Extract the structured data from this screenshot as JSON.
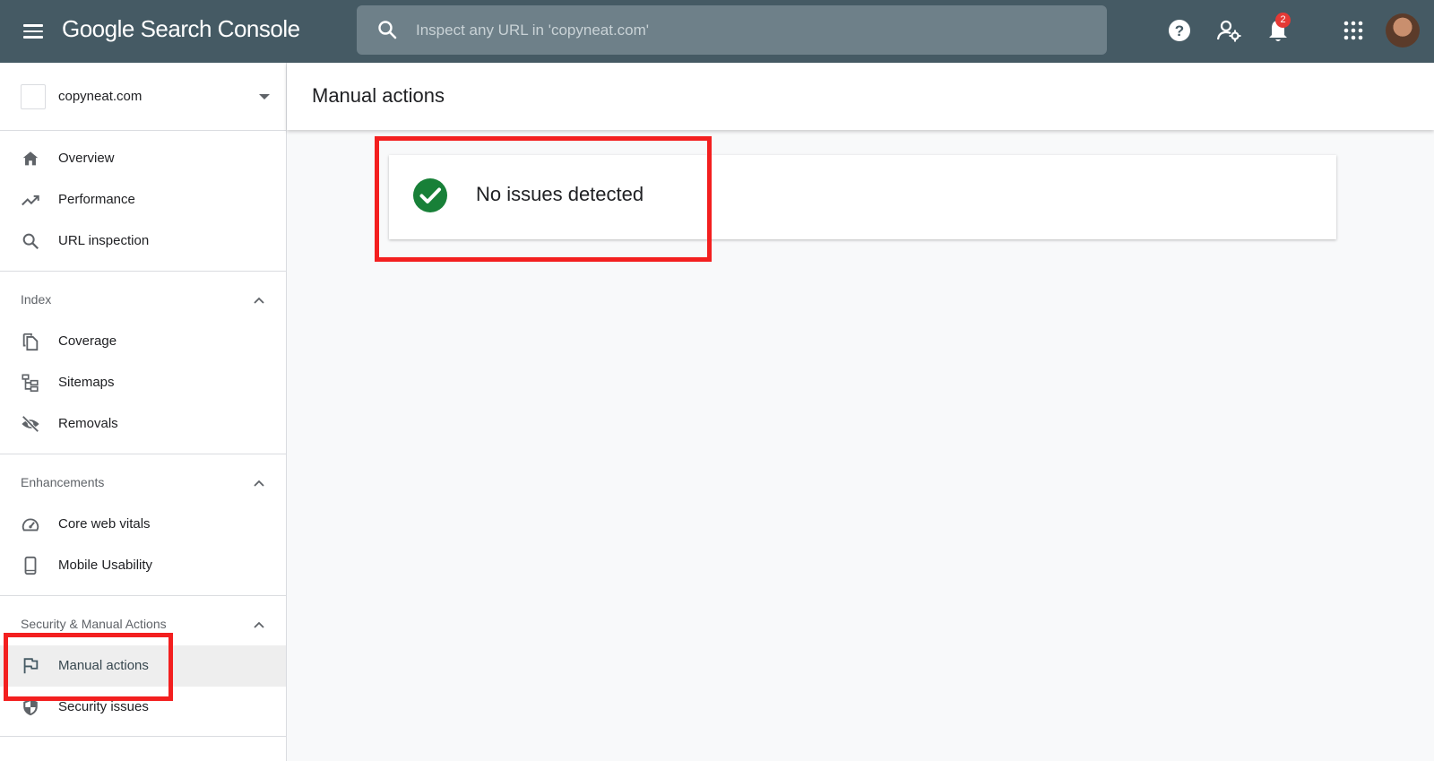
{
  "app": {
    "title": "Google Search Console"
  },
  "search": {
    "placeholder": "Inspect any URL in 'copyneat.com'"
  },
  "notifications": {
    "count": "2"
  },
  "property": {
    "name": "copyneat.com"
  },
  "sidebar": {
    "top_items": [
      {
        "label": "Overview",
        "icon": "home-icon"
      },
      {
        "label": "Performance",
        "icon": "trending-up-icon"
      },
      {
        "label": "URL inspection",
        "icon": "search-icon"
      }
    ],
    "sections": [
      {
        "title": "Index",
        "items": [
          {
            "label": "Coverage",
            "icon": "copy-icon"
          },
          {
            "label": "Sitemaps",
            "icon": "sitemap-icon"
          },
          {
            "label": "Removals",
            "icon": "eye-off-icon"
          }
        ]
      },
      {
        "title": "Enhancements",
        "items": [
          {
            "label": "Core web vitals",
            "icon": "gauge-icon"
          },
          {
            "label": "Mobile Usability",
            "icon": "smartphone-icon"
          }
        ]
      },
      {
        "title": "Security & Manual Actions",
        "items": [
          {
            "label": "Manual actions",
            "icon": "flag-icon",
            "active": true
          },
          {
            "label": "Security issues",
            "icon": "shield-icon"
          }
        ]
      }
    ]
  },
  "main": {
    "page_title": "Manual actions",
    "status_text": "No issues detected"
  },
  "colors": {
    "topbar": "#455a64",
    "success": "#188038",
    "highlight": "#f31f1f"
  }
}
